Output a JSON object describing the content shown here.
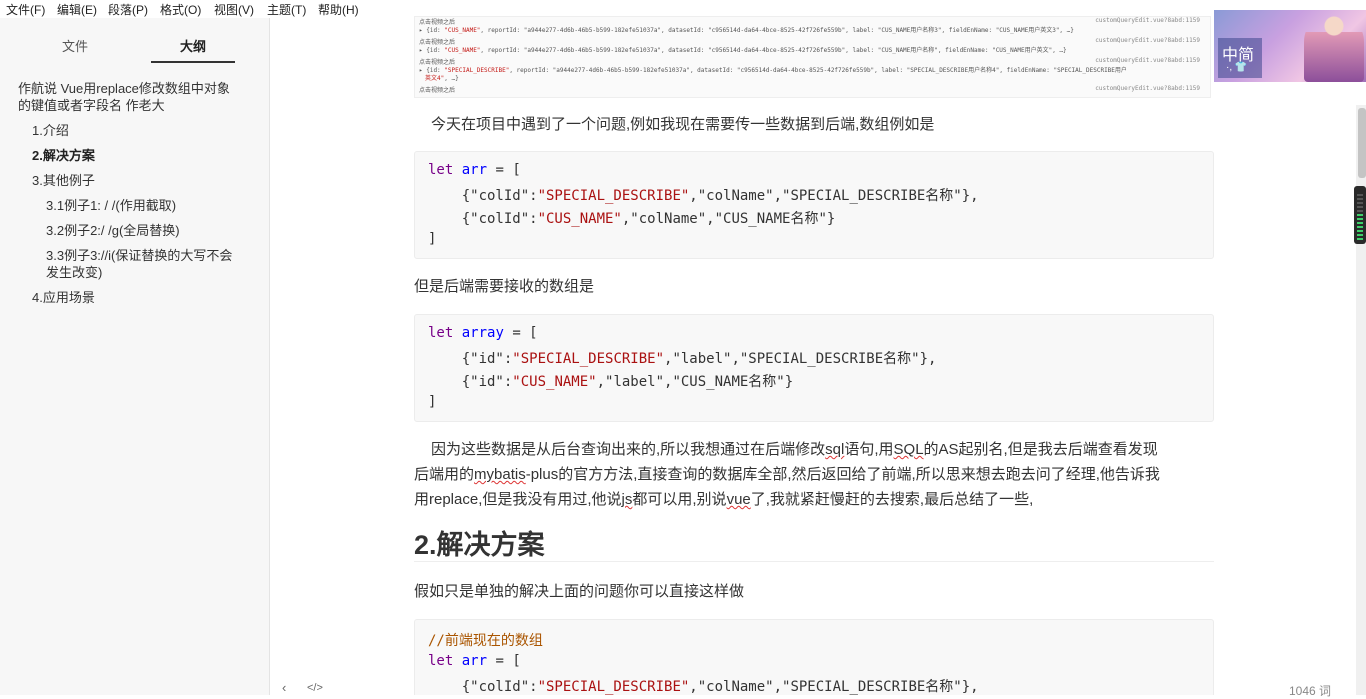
{
  "menu": [
    "文件(F)",
    "编辑(E)",
    "段落(P)",
    "格式(O)",
    "视图(V)",
    "主题(T)",
    "帮助(H)"
  ],
  "sidebar": {
    "tab_files": "文件",
    "tab_outline": "大纲",
    "outline_title": [
      "作航说 Vue用replace修改数组中对象",
      "的键值或者字段名 作老大"
    ],
    "items": [
      {
        "label": "1.介绍"
      },
      {
        "label": "2.解决方案"
      },
      {
        "label": "3.其他例子"
      },
      {
        "label": "3.1例子1: / /(作用截取)"
      },
      {
        "label": "3.2例子2:/ /g(全局替换)"
      },
      {
        "label": "3.3例子3://i(保证替换的大写不会"
      },
      {
        "label": "发生改变)"
      },
      {
        "label": "4.应用场景"
      }
    ]
  },
  "screenshot": {
    "lines": [
      {
        "prefix": "点击视频之后",
        "text": "",
        "link": "customQueryEdit.vue?8abd:1159"
      },
      {
        "prefix": "▸ {id: ",
        "red": "\"CUS_NAME\"",
        "text": ", reportId: \"a944e277-4d6b-46b5-b599-182efe51037a\", datasetId: \"c956514d-da64-4bce-8525-42f726fe559b\", label: \"CUS_NAME用户名称3\", fieldEnName: \"CUS_NAME用户英文3\", …}",
        "link": ""
      },
      {
        "prefix": "点击视频之后",
        "text": "",
        "link": "customQueryEdit.vue?8abd:1159"
      },
      {
        "prefix": "▸ {id: ",
        "red": "\"CUS_NAME\"",
        "text": ", reportId: \"a944e277-4d6b-46b5-b599-182efe51037a\", datasetId: \"c956514d-da64-4bce-8525-42f726fe559b\", label: \"CUS_NAME用户名称\", fieldEnName: \"CUS_NAME用户英文\", …}",
        "link": ""
      },
      {
        "prefix": "点击视频之后",
        "text": "",
        "link": "customQueryEdit.vue?8abd:1159"
      },
      {
        "prefix": "▸ {id: ",
        "red": "\"SPECIAL_DESCRIBE\"",
        "text": ", reportId: \"a944e277-4d6b-46b5-b599-182efe51037a\", datasetId: \"c956514d-da64-4bce-8525-42f726fe559b\", label: \"SPECIAL_DESCRIBE用户名称4\", fieldEnName: \"SPECIAL_DESCRIBE用户",
        "link": ""
      },
      {
        "prefix": "",
        "red": "英文4\"",
        "text": ", …}",
        "link": ""
      },
      {
        "prefix": "点击视频之后",
        "text": "",
        "link": "customQueryEdit.vue?8abd:1159"
      }
    ]
  },
  "content": {
    "para1": "今天在项目中遇到了一个问题,例如我现在需要传一些数据到后端,数组例如是",
    "code1": {
      "line1": {
        "kw": "let",
        "var": "arr",
        "rest": " = ["
      },
      "line2": {
        "a": "    {\"colId\":",
        "s": "\"SPECIAL_DESCRIBE\"",
        "b": ",\"colName\",\"SPECIAL_DESCRIBE名称\"},"
      },
      "line3": {
        "a": "    {\"colId\":",
        "s": "\"CUS_NAME\"",
        "b": ",\"colName\",\"CUS_NAME名称\"}"
      },
      "line4": "]"
    },
    "para2": "但是后端需要接收的数组是",
    "code2": {
      "line1": {
        "kw": "let",
        "var": "array",
        "rest": " = ["
      },
      "line2": {
        "a": "    {\"id\":",
        "s": "\"SPECIAL_DESCRIBE\"",
        "b": ",\"label\",\"SPECIAL_DESCRIBE名称\"},"
      },
      "line3": {
        "a": "    {\"id\":",
        "s": "\"CUS_NAME\"",
        "b": ",\"label\",\"CUS_NAME名称\"}"
      },
      "line4": "]"
    },
    "para3": {
      "l1a": "因为这些数据是从后台查询出来的,所以我想通过在后端修改",
      "l1b": "sql",
      "l1c": "语句,用",
      "l1d": "SQL",
      "l1e": "的AS起别名,但是我去后端查看发现",
      "l2a": "后端用的",
      "l2b": "mybatis",
      "l2c": "-plus的官方方法,直接查询的数据库全部,然后返回给了前端,所以思来想去跑去问了经理,他告诉我",
      "l3a": "用replace,但是我没有用过,他说",
      "l3b": "js",
      "l3c": "都可以用,别说",
      "l3d": "vue",
      "l3e": "了,我就紧赶慢赶的去搜索,最后总结了一些,"
    },
    "heading2": "2.解决方案",
    "para4": "假如只是单独的解决上面的问题你可以直接这样做",
    "code3": {
      "comment": "//前端现在的数组",
      "line1": {
        "kw": "let",
        "var": "arr",
        "rest": " = ["
      },
      "line2": {
        "a": "    {\"colId\":",
        "s": "\"SPECIAL_DESCRIBE\"",
        "b": ",\"colName\",\"SPECIAL_DESCRIBE名称\"},"
      }
    }
  },
  "ime": {
    "label": "中简",
    "sub": "·, 👕"
  },
  "status": {
    "back_icon": "‹",
    "source_icon": "</>",
    "word_count": "1046 词"
  },
  "meter_level": 0.55
}
